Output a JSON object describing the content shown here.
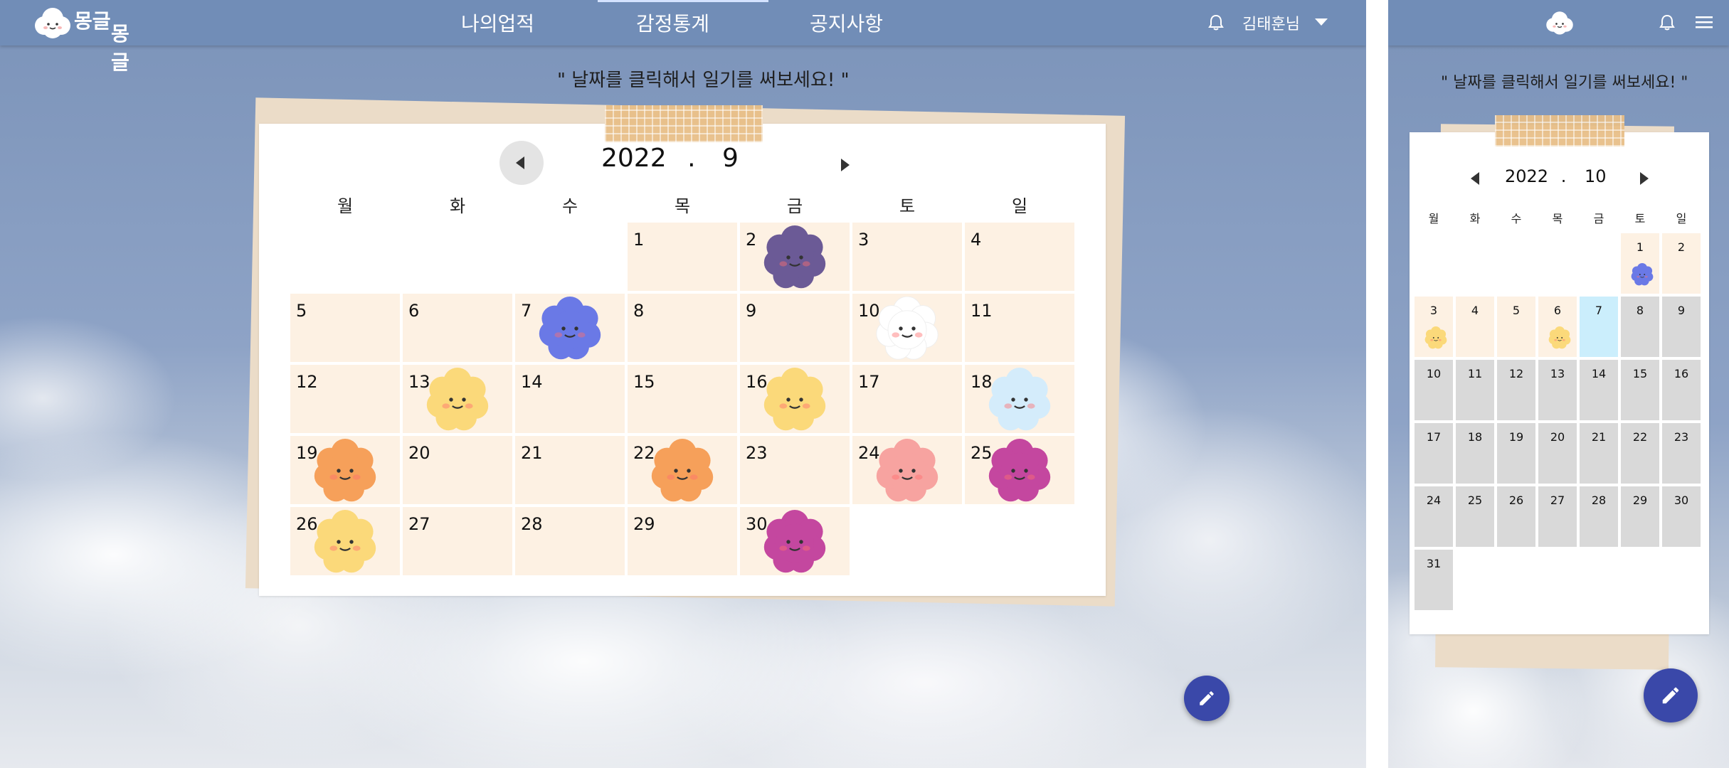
{
  "app": {
    "logo_text_line1": "몽글",
    "logo_text_line2": "몽글",
    "nav": [
      {
        "label": "나의업적"
      },
      {
        "label": "감정통계"
      },
      {
        "label": "공지사항"
      }
    ],
    "user_label": "김태훈님"
  },
  "quote": "\" 날짜를 클릭해서 일기를 써보세요! \"",
  "desktop": {
    "year": "2022",
    "dot": ".",
    "month": "9",
    "weekdays": [
      "월",
      "화",
      "수",
      "목",
      "금",
      "토",
      "일"
    ],
    "days": [
      "1",
      "2",
      "3",
      "4",
      "5",
      "6",
      "7",
      "8",
      "9",
      "10",
      "11",
      "12",
      "13",
      "14",
      "15",
      "16",
      "17",
      "18",
      "19",
      "20",
      "21",
      "22",
      "23",
      "24",
      "25",
      "26",
      "27",
      "28",
      "29",
      "30"
    ],
    "mood_colors": {
      "2": "#6b5a96",
      "7": "#6a79e6",
      "10": "#ffffff",
      "13": "#fbd97a",
      "16": "#fbd97a",
      "18": "#d4ecfb",
      "19": "#f6a05a",
      "22": "#f6a05a",
      "24": "#f7a3a0",
      "25": "#c4479f",
      "26": "#fbd97a",
      "30": "#c4479f"
    }
  },
  "mobile": {
    "year": "2022",
    "dot": ".",
    "month": "10",
    "weekdays": [
      "월",
      "화",
      "수",
      "목",
      "금",
      "토",
      "일"
    ],
    "days": [
      "1",
      "2",
      "3",
      "4",
      "5",
      "6",
      "7",
      "8",
      "9",
      "10",
      "11",
      "12",
      "13",
      "14",
      "15",
      "16",
      "17",
      "18",
      "19",
      "20",
      "21",
      "22",
      "23",
      "24",
      "25",
      "26",
      "27",
      "28",
      "29",
      "30",
      "31"
    ],
    "mood_colors": {
      "1": "#6a79e6",
      "3": "#fbd97a",
      "6": "#fbd97a"
    },
    "today": "7"
  },
  "colors": {
    "cell_bg": "#fdf1e3",
    "cell_future_bg": "#d9d9d9",
    "today_bg": "#cbeefc",
    "fab_bg": "#3a48a9",
    "topbar_bg": "#708cb6"
  },
  "icons": {
    "logo": "cloud-logo-icon",
    "bell": "bell-icon",
    "menu": "hamburger-icon",
    "fab": "pencil-icon"
  }
}
